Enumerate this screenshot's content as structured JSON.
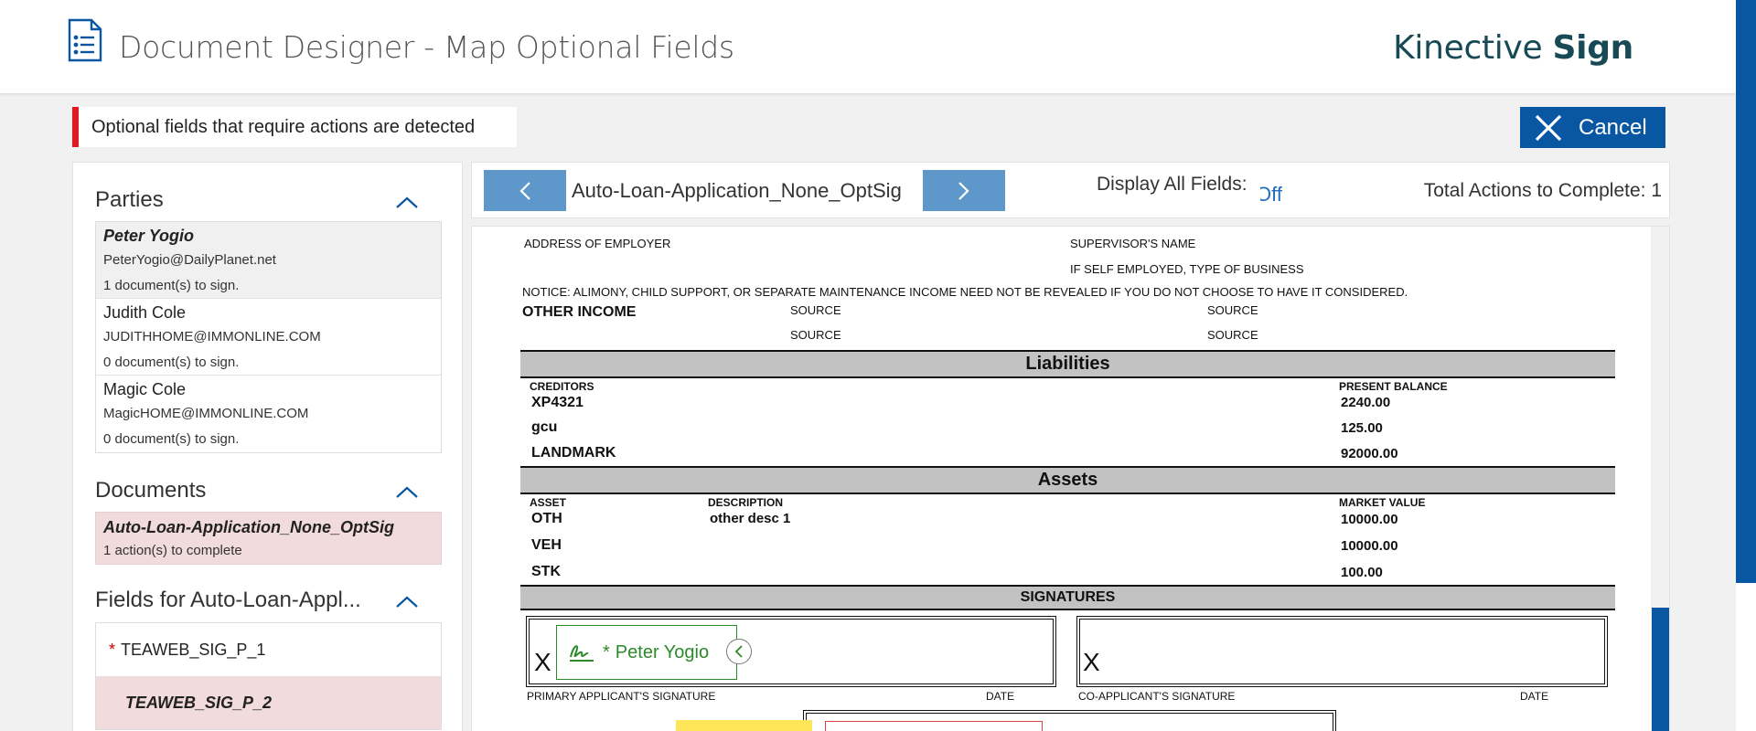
{
  "header": {
    "title": "Document Designer - Map Optional Fields",
    "brand_light": "Kinective",
    "brand_bold": "Sign"
  },
  "alert": {
    "text": "Optional fields that require actions are detected",
    "color": "#e0191f"
  },
  "cancel_label": "Cancel",
  "parties": {
    "title": "Parties",
    "items": [
      {
        "name": "Peter Yogio",
        "email": "PeterYogio@DailyPlanet.net",
        "count": "1 document(s) to sign."
      },
      {
        "name": "Judith Cole",
        "email": "JUDITHHOME@IMMONLINE.COM",
        "count": "0 document(s) to sign."
      },
      {
        "name": "Magic Cole",
        "email": "MagicHOME@IMMONLINE.COM",
        "count": "0 document(s) to sign."
      }
    ]
  },
  "documents": {
    "title": "Documents",
    "items": [
      {
        "name": "Auto-Loan-Application_None_OptSig",
        "status": "1 action(s) to complete"
      }
    ]
  },
  "fields": {
    "title": "Fields for Auto-Loan-Appl...",
    "items": [
      {
        "name": "TEAWEB_SIG_P_1",
        "required": "*"
      },
      {
        "name": "TEAWEB_SIG_P_2"
      }
    ]
  },
  "toolbar": {
    "doc_name": "Auto-Loan-Application_None_OptSig",
    "display_label": "Display All Fields:",
    "display_value": "Off",
    "total_label": "Total Actions to Complete: 1"
  },
  "pdf": {
    "address_employer": "ADDRESS OF EMPLOYER",
    "supervisor": "SUPERVISOR'S NAME",
    "self_employed": "IF SELF EMPLOYED, TYPE OF BUSINESS",
    "notice": "NOTICE: ALIMONY, CHILD SUPPORT, OR SEPARATE MAINTENANCE INCOME NEED NOT BE REVEALED IF YOU DO NOT CHOOSE TO HAVE IT CONSIDERED.",
    "other_income": "OTHER INCOME",
    "source": "SOURCE",
    "liabilities": {
      "title": "Liabilities",
      "col_creditors": "CREDITORS",
      "col_balance": "PRESENT BALANCE",
      "rows": [
        {
          "creditor": "XP4321",
          "balance": "2240.00"
        },
        {
          "creditor": "gcu",
          "balance": "125.00"
        },
        {
          "creditor": "LANDMARK",
          "balance": "92000.00"
        }
      ]
    },
    "assets": {
      "title": "Assets",
      "col_asset": "ASSET",
      "col_desc": "DESCRIPTION",
      "col_value": "MARKET VALUE",
      "rows": [
        {
          "asset": "OTH",
          "desc": "other desc 1",
          "value": "10000.00"
        },
        {
          "asset": "VEH",
          "desc": "",
          "value": "10000.00"
        },
        {
          "asset": "STK",
          "desc": "",
          "value": "100.00"
        }
      ]
    },
    "signatures": {
      "title": "SIGNATURES",
      "x": "X",
      "primary": "PRIMARY APPLICANT'S SIGNATURE",
      "co": "CO-APPLICANT'S SIGNATURE",
      "date": "DATE"
    },
    "sig_tag": {
      "required": "*",
      "name": "Peter Yogio"
    }
  },
  "colors": {
    "primary": "#0957a2",
    "nav": "#5e97c9",
    "brand": "#174a55",
    "selected_bg": "#f1dbdc",
    "signature_green": "#2b8a2b"
  }
}
